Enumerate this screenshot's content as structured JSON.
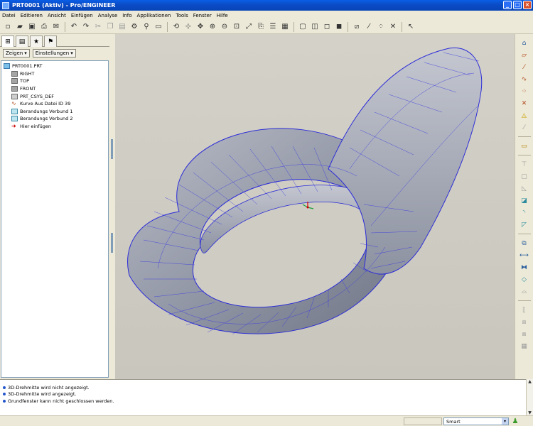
{
  "window": {
    "title": "PRT0001 (Aktiv) - Pro/ENGINEER",
    "minimize": "_",
    "maximize": "□",
    "close": "×"
  },
  "menu": [
    "Datei",
    "Editieren",
    "Ansicht",
    "Einfügen",
    "Analyse",
    "Info",
    "Applikationen",
    "Tools",
    "Fenster",
    "Hilfe"
  ],
  "toolbar_icons": [
    "new-icon",
    "open-icon",
    "save-icon",
    "print-icon",
    "email-icon",
    "undo-icon",
    "redo-icon",
    "cut-icon",
    "copy-icon",
    "paste-icon",
    "regenerate-icon",
    "find-icon",
    "select-box-icon",
    "repaint-icon",
    "spin-center-icon",
    "orient-icon",
    "zoom-in-icon",
    "zoom-out-icon",
    "refit-icon",
    "reorient-icon",
    "saved-views-icon",
    "layers-icon",
    "view-manager-icon",
    "wireframe-icon",
    "hidden-line-icon",
    "no-hidden-icon",
    "shading-icon",
    "datum-planes-icon",
    "datum-axes-icon",
    "datum-points-icon",
    "csys-icon",
    "context-help-icon"
  ],
  "left_panel": {
    "show_button": "Zeigen",
    "settings_button": "Einstellungen",
    "tree": [
      {
        "label": "PRT0001.PRT",
        "icon": "part-icon"
      },
      {
        "label": "RIGHT",
        "icon": "datum-plane-icon"
      },
      {
        "label": "TOP",
        "icon": "datum-plane-icon"
      },
      {
        "label": "FRONT",
        "icon": "datum-plane-icon"
      },
      {
        "label": "PRT_CSYS_DEF",
        "icon": "csys-icon"
      },
      {
        "label": "Kurve Aus Datei ID 39",
        "icon": "curve-icon"
      },
      {
        "label": "Berandungs Verbund 1",
        "icon": "boundary-blend-icon"
      },
      {
        "label": "Berandungs Verbund 2",
        "icon": "boundary-blend-icon"
      },
      {
        "label": "Hier einfügen",
        "icon": "insert-here-icon"
      }
    ]
  },
  "right_tools": [
    "datum-plane-tool-icon",
    "sketch-plane-icon",
    "datum-axis-icon",
    "curve-tool-icon",
    "point-tool-icon",
    "csys-tool-icon",
    "analysis-tool-icon",
    "extrude-ghost-icon",
    "sketch-tool-icon",
    "hole-tool-icon",
    "shell-tool-icon",
    "rib-tool-icon",
    "draft-tool-icon",
    "round-tool-icon",
    "chamfer-tool-icon",
    "copy-feature-icon",
    "mirror-tool-icon",
    "merge-tool-icon",
    "trim-tool-icon",
    "extend-tool-icon",
    "offset-tool-icon",
    "thicken-tool-icon",
    "solidify-tool-icon",
    "pattern-tool-icon"
  ],
  "messages": [
    "3D-Drehmitte wird nicht angezeigt.",
    "3D-Drehmitte wird angezeigt.",
    "Grundfenster kann nicht geschlossen werden."
  ],
  "status": {
    "filter_value": "Smart"
  }
}
